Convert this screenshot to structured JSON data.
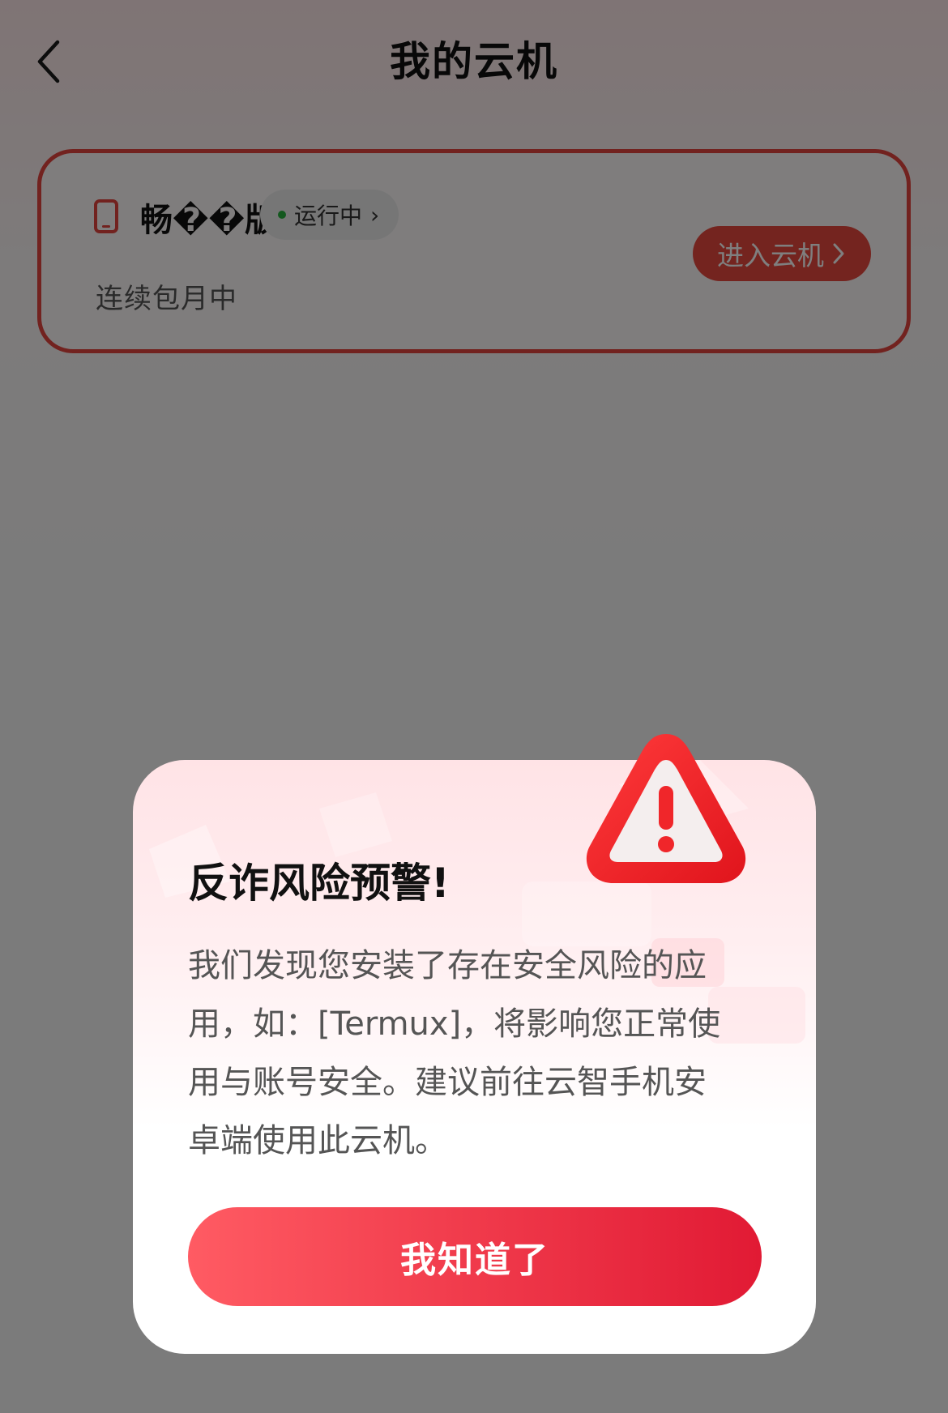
{
  "header": {
    "title": "我的云机",
    "back_icon": "chevron-left-icon"
  },
  "card": {
    "plan_name": "畅��版",
    "status_text": "运行中",
    "status_color": "#27b13d",
    "renewal_text": "连续包月中",
    "enter_label": "进入云机",
    "accent_color": "#e4443e"
  },
  "dialog": {
    "title": "反诈风险预警!",
    "body_lines": [
      "我们发现您安装了存在安全风险的应",
      "用，如：[Termux]，将影响您正常使",
      "用与账号安全。建议前往云智手机安",
      "卓端使用此云机。"
    ],
    "confirm_label": "我知道了",
    "icon": "warning-triangle-icon"
  }
}
